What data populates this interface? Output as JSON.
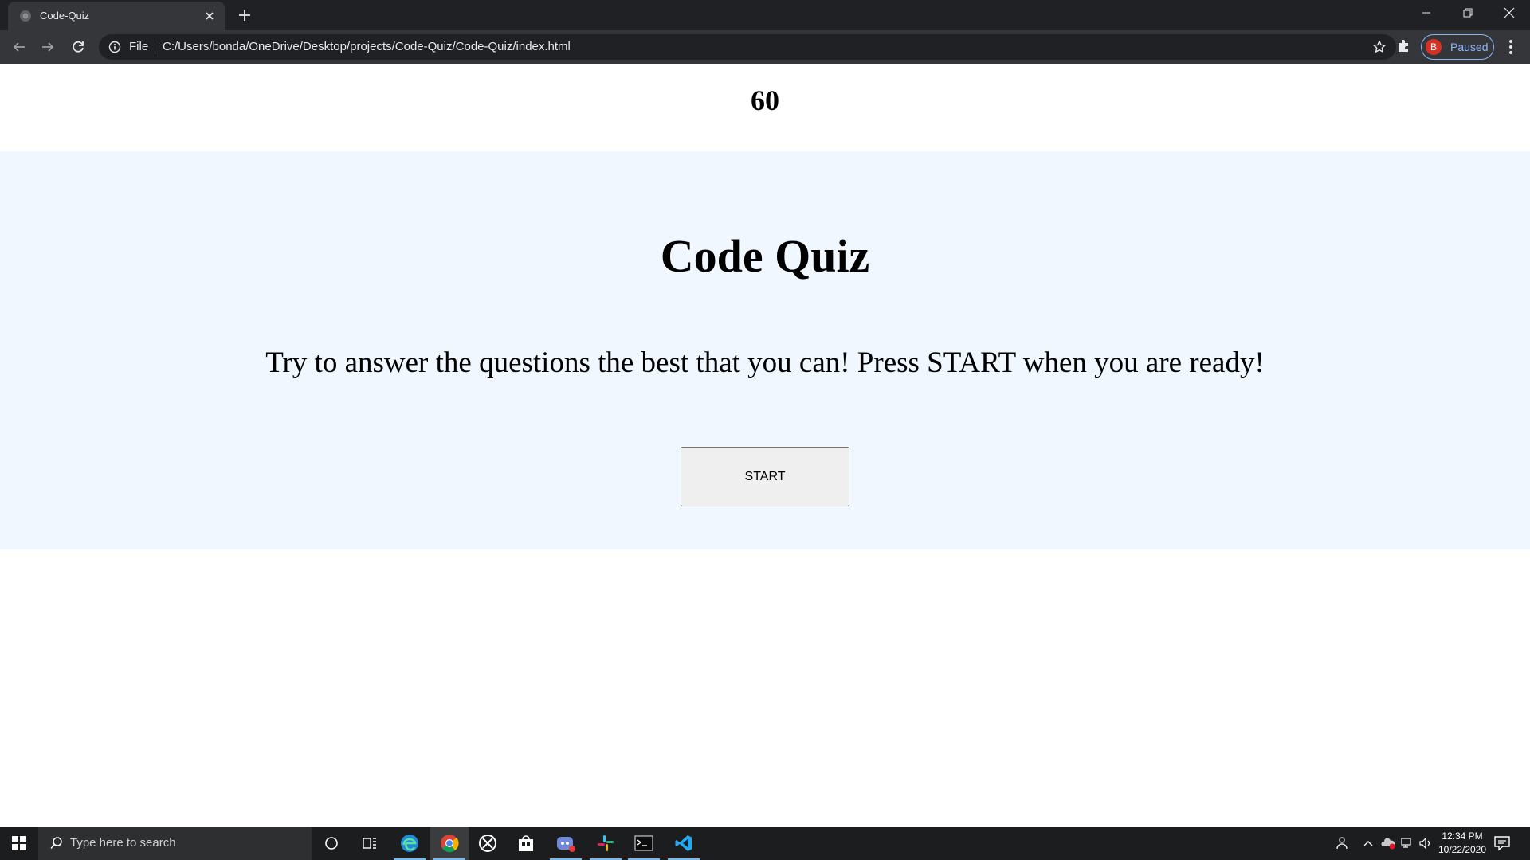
{
  "browser": {
    "tab_title": "Code-Quiz",
    "scheme_label": "File",
    "url": "C:/Users/bonda/OneDrive/Desktop/projects/Code-Quiz/Code-Quiz/index.html",
    "profile_initial": "B",
    "profile_status": "Paused",
    "accent_color": "#8ab4f8"
  },
  "page": {
    "timer": "60",
    "title": "Code Quiz",
    "intro": "Try to answer the questions the best that you can! Press START when you are ready!",
    "start_label": "START",
    "hero_background": "#f0f7ff"
  },
  "taskbar": {
    "search_placeholder": "Type here to search",
    "time": "12:34 PM",
    "date": "10/22/2020",
    "apps": [
      "cortana-icon",
      "task-view-icon",
      "edge-icon",
      "chrome-icon",
      "xbox-icon",
      "store-icon",
      "discord-icon",
      "slack-icon",
      "terminal-icon",
      "vscode-icon"
    ]
  }
}
